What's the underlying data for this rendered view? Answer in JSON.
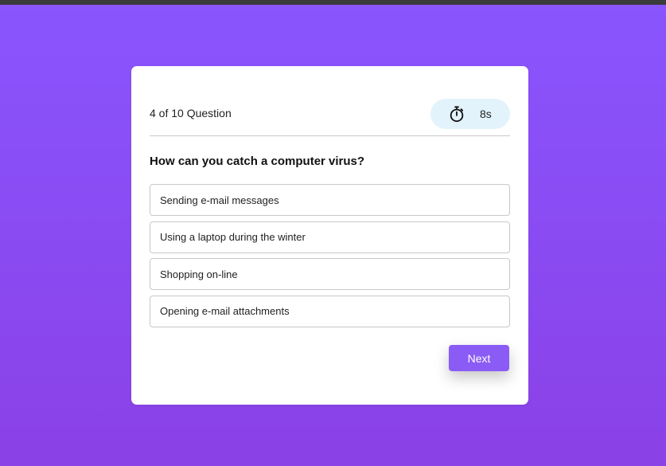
{
  "quiz": {
    "counter": "4 of 10 Question",
    "timer": {
      "icon": "stopwatch-icon",
      "value": "8s"
    },
    "question": "How can you catch a computer virus?",
    "options": [
      {
        "label": "Sending e-mail messages"
      },
      {
        "label": "Using a laptop during the winter"
      },
      {
        "label": "Shopping on-line"
      },
      {
        "label": "Opening e-mail attachments"
      }
    ],
    "next_label": "Next"
  },
  "colors": {
    "background_top": "#8a55fe",
    "background_bottom": "#8a41e6",
    "accent": "#8b5bf5",
    "timer_background": "#e3f3fc"
  }
}
